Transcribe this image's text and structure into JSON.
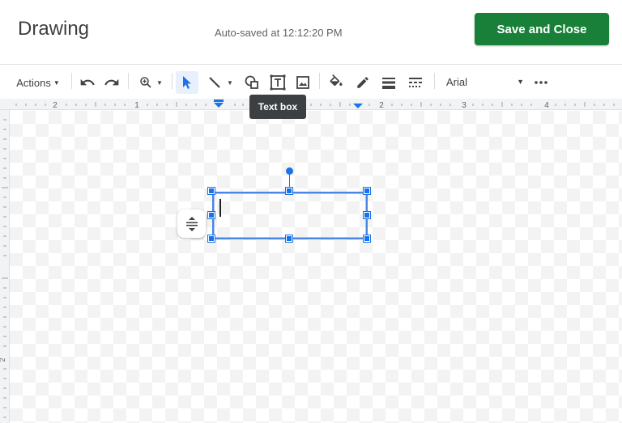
{
  "header": {
    "title": "Drawing",
    "autosave": "Auto-saved at 12:12:20 PM",
    "save_label": "Save and Close"
  },
  "toolbar": {
    "actions_label": "Actions",
    "font": "Arial"
  },
  "tooltip": {
    "text": "Text box"
  },
  "ruler": {
    "marks": [
      "2",
      "1",
      "1",
      "2",
      "3",
      "4"
    ],
    "vertical_marks": [
      "1",
      "2"
    ]
  },
  "colors": {
    "accent": "#1a73e8",
    "save_button": "#188038"
  }
}
